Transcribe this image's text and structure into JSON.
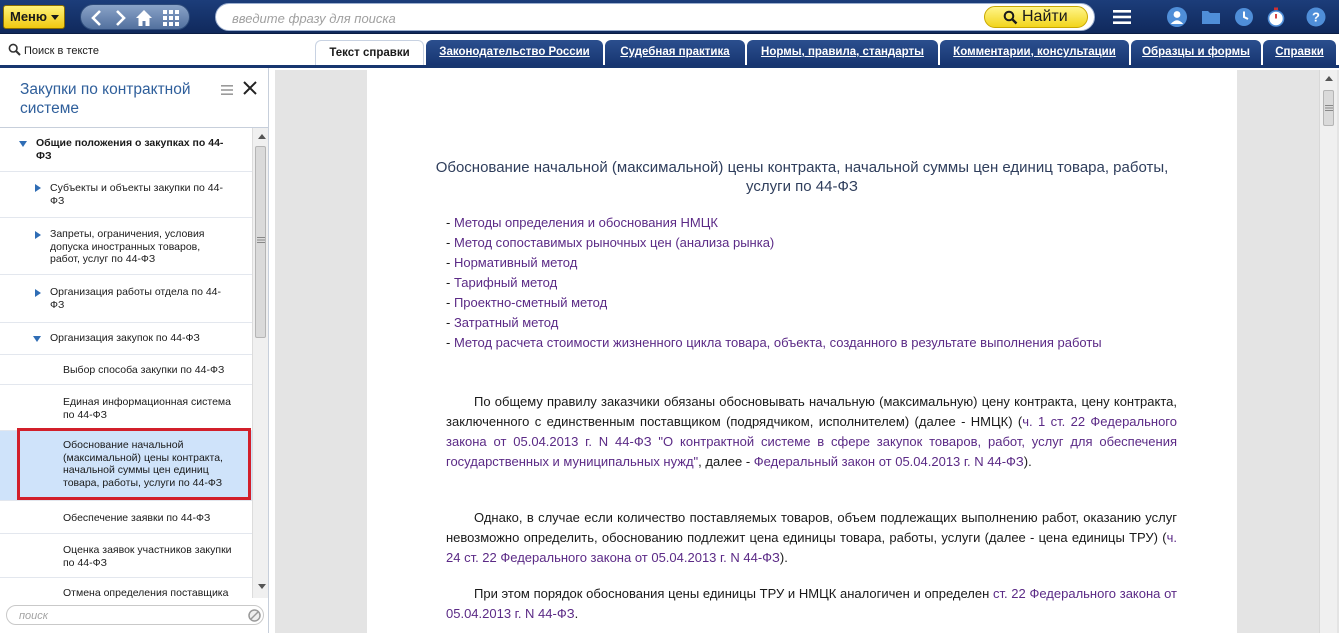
{
  "toolbar": {
    "menu_label": "Меню",
    "search_placeholder": "введите фразу для поиска",
    "find_label": "Найти"
  },
  "tabs": {
    "search_in_text": "Поиск в тексте",
    "items": [
      {
        "label": "Текст справки"
      },
      {
        "label": "Законодательство России"
      },
      {
        "label": "Судебная практика"
      },
      {
        "label": "Нормы, правила, стандарты"
      },
      {
        "label": "Комментарии, консультации"
      },
      {
        "label": "Образцы и формы"
      },
      {
        "label": "Справки"
      }
    ]
  },
  "sidebar": {
    "title": "Закупки по контрактной системе",
    "filter_placeholder": "поиск",
    "items": [
      {
        "label": "Общие положения о закупках по 44-ФЗ"
      },
      {
        "label": "Субъекты и объекты закупки по 44-ФЗ"
      },
      {
        "label": "Запреты, ограничения, условия допуска иностранных товаров, работ, услуг по 44-ФЗ"
      },
      {
        "label": "Организация работы отдела по 44-ФЗ"
      },
      {
        "label": "Организация закупок по 44-ФЗ"
      },
      {
        "label": "Выбор способа закупки по 44-ФЗ"
      },
      {
        "label": "Единая информационная система по 44-ФЗ"
      },
      {
        "label": "Обоснование начальной (максимальной) цены контракта, начальной суммы цен единиц товара, работы, услуги по 44-ФЗ"
      },
      {
        "label": "Обеспечение заявки по 44-ФЗ"
      },
      {
        "label": "Оценка заявок участников закупки по 44-ФЗ"
      },
      {
        "label": "Отмена определения поставщика"
      }
    ]
  },
  "document": {
    "title": "Обоснование начальной (максимальной) цены контракта, начальной суммы цен единиц товара, работы, услуги по 44-ФЗ",
    "bullet_prefix": "- ",
    "bullets": [
      "Методы определения и обоснования НМЦК",
      "Метод сопоставимых рыночных цен (анализа рынка)",
      "Нормативный метод",
      "Тарифный метод",
      "Проектно-сметный метод",
      "Затратный метод",
      "Метод расчета стоимости жизненного цикла товара, объекта, созданного в результате выполнения работы"
    ],
    "p1_text": "По общему правилу заказчики обязаны обосновывать начальную (максимальную) цену контракта, цену контракта, заключенного с единственным поставщиком (подрядчиком, исполнителем) (далее - НМЦК) (",
    "p1_link1": "ч. 1 ст. 22 Федерального закона от 05.04.2013 г. N 44-ФЗ \"О контрактной системе в сфере закупок товаров, работ, услуг для обеспечения государственных и муниципальных нужд\"",
    "p1_mid": ", далее - ",
    "p1_link2": "Федеральный закон от 05.04.2013 г. N 44-ФЗ",
    "p1_end": ").",
    "p2_text": "Однако, в случае если количество поставляемых товаров, объем подлежащих выполнению работ, оказанию услуг невозможно определить, обоснованию подлежит цена единицы товара, работы, услуги (далее - цена единицы ТРУ) (",
    "p2_link": "ч. 24 ст. 22 Федерального закона от 05.04.2013 г. N 44-ФЗ",
    "p2_end": ").",
    "p3_text": "При этом порядок обоснования цены единицы ТРУ и НМЦК аналогичен и определен ",
    "p3_link": "ст. 22 Федерального закона от 05.04.2013 г. N 44-ФЗ",
    "p3_end": "."
  },
  "colors": {
    "toolbar_bg": "#1c3d7a",
    "accent_yellow": "#f2d51c",
    "link": "#5b2a86",
    "selected_row": "#cfe3fa",
    "highlight_frame": "#d21f2a"
  }
}
